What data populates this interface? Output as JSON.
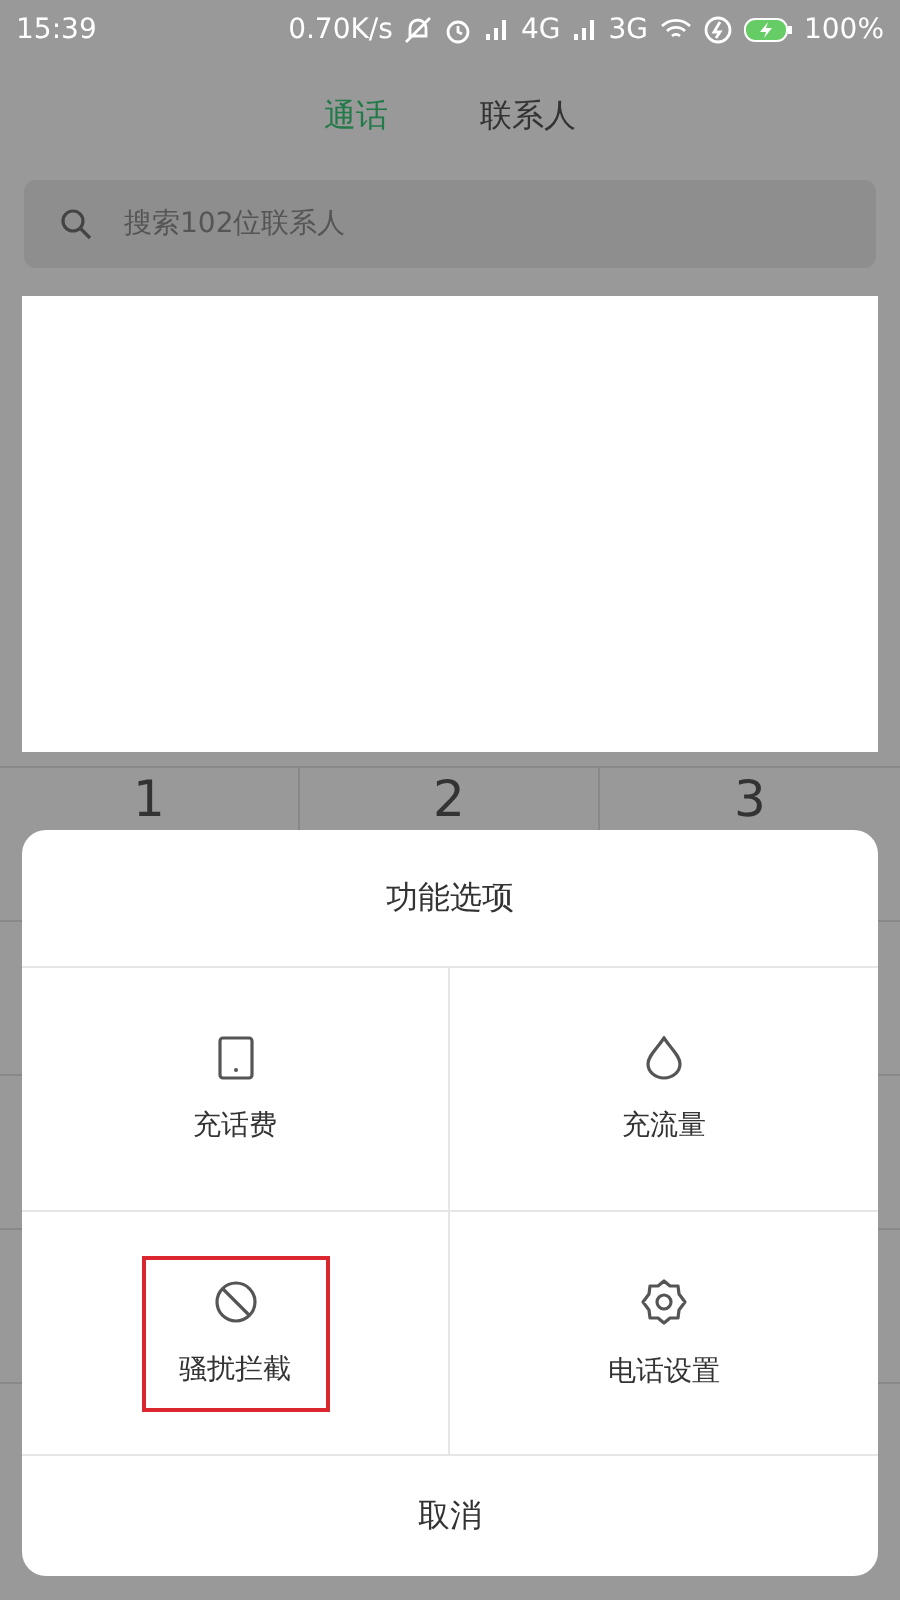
{
  "status_bar": {
    "time": "15:39",
    "speed": "0.70K/s",
    "network_1": "4G",
    "network_2": "3G",
    "battery": "100%"
  },
  "tabs": [
    {
      "label": "通话",
      "selected": true
    },
    {
      "label": "联系人",
      "selected": false
    }
  ],
  "search": {
    "placeholder": "搜索102位联系人"
  },
  "keypad": {
    "keys": [
      "1",
      "2",
      "3"
    ]
  },
  "dialog": {
    "title": "功能选项",
    "items": [
      {
        "kind": "phone",
        "label": "充话费",
        "highlighted": false
      },
      {
        "kind": "drop",
        "label": "充流量",
        "highlighted": false
      },
      {
        "kind": "block",
        "label": "骚扰拦截",
        "highlighted": true
      },
      {
        "kind": "gear",
        "label": "电话设置",
        "highlighted": false
      }
    ],
    "cancel": "取消"
  }
}
